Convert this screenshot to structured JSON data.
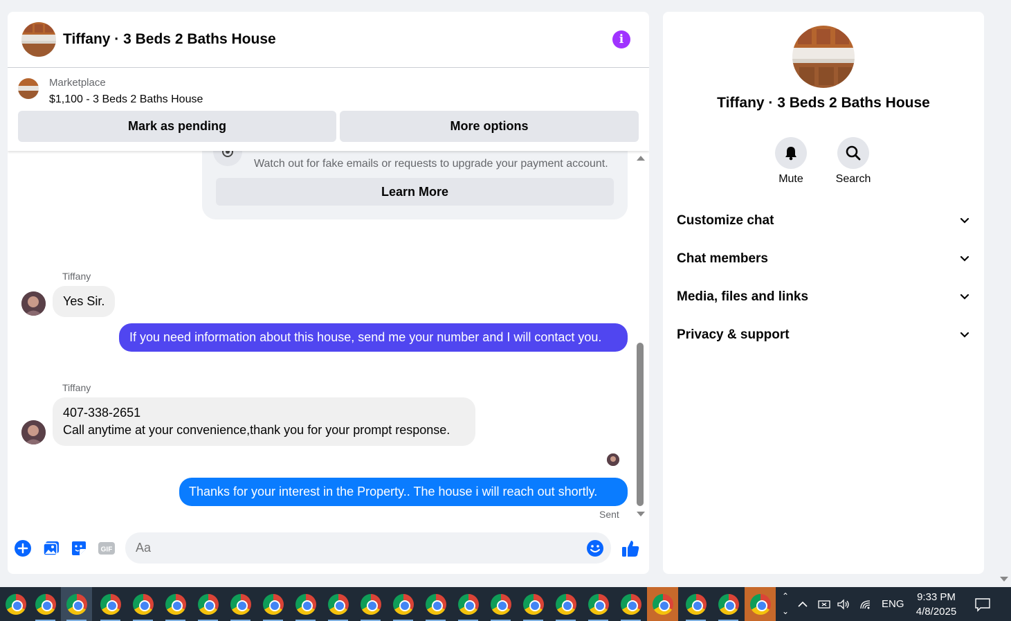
{
  "chat": {
    "title": "Tiffany · 3 Beds 2 Baths House",
    "listing_label": "Marketplace",
    "listing_price": "$1,100 - 3 Beds 2 Baths House",
    "mark_pending": "Mark as pending",
    "more_options": "More options",
    "warning_text": "Watch out for fake emails or requests to upgrade your payment account.",
    "learn_more": "Learn More",
    "messages": [
      {
        "sender": "Tiffany",
        "text": "Yes Sir."
      },
      {
        "text": "If you need information about this house, send me your number and I will contact you."
      },
      {
        "sender": "Tiffany",
        "line1": "407-338-2651",
        "line2": "Call anytime at your convenience,thank you for your prompt response."
      },
      {
        "text": "Thanks for your interest in the Property.. The house i will reach  out shortly."
      }
    ],
    "sent_label": "Sent",
    "input_placeholder": "Aa"
  },
  "info": {
    "title": "Tiffany · 3 Beds 2 Baths House",
    "mute_label": "Mute",
    "search_label": "Search",
    "sections": [
      "Customize chat",
      "Chat members",
      "Media, files and links",
      "Privacy & support"
    ]
  },
  "taskbar": {
    "language": "ENG",
    "time": "9:33 PM",
    "date": "4/8/2025"
  },
  "colors": {
    "outgoing_purple": "#5046f0",
    "outgoing_blue": "#0a7cff",
    "accent_blue": "#0866ff",
    "info_purple": "#a033ff"
  }
}
